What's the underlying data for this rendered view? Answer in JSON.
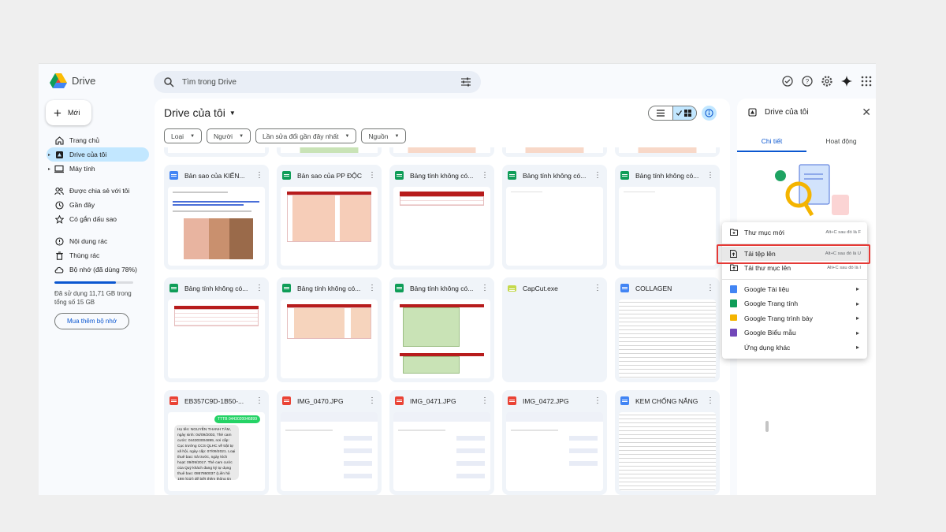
{
  "app": {
    "name": "Drive"
  },
  "search": {
    "placeholder": "Tìm trong Drive"
  },
  "sidebar": {
    "new_label": "Mới",
    "items": [
      {
        "label": "Trang chủ",
        "icon": "home-icon"
      },
      {
        "label": "Drive của tôi",
        "icon": "my-drive-icon",
        "active": true
      },
      {
        "label": "Máy tính",
        "icon": "computer-icon"
      },
      {
        "label": "Được chia sẻ với tôi",
        "icon": "shared-icon"
      },
      {
        "label": "Gần đây",
        "icon": "clock-icon"
      },
      {
        "label": "Có gắn dấu sao",
        "icon": "star-icon"
      },
      {
        "label": "Nội dung rác",
        "icon": "spam-icon"
      },
      {
        "label": "Thùng rác",
        "icon": "trash-icon"
      },
      {
        "label": "Bộ nhớ (đã dùng 78%)",
        "icon": "cloud-icon"
      }
    ],
    "storage_used_fraction": 0.78,
    "storage_text": "Đã sử dụng 11,71 GB trong tổng số 15 GB",
    "buy_label": "Mua thêm bộ nhớ"
  },
  "main": {
    "title": "Drive của tôi",
    "filters": [
      "Loại",
      "Người",
      "Lần sửa đổi gần đây nhất",
      "Nguồn"
    ],
    "files": [
      {
        "name": "Bản sao của KIẾN...",
        "type": "doc"
      },
      {
        "name": "Bản sao của PP ĐỘC...",
        "type": "sheet"
      },
      {
        "name": "Bảng tính không có...",
        "type": "sheet"
      },
      {
        "name": "Bảng tính không có...",
        "type": "sheet"
      },
      {
        "name": "Bảng tính không có...",
        "type": "sheet"
      },
      {
        "name": "Bảng tính không có...",
        "type": "sheet"
      },
      {
        "name": "Bảng tính không có...",
        "type": "sheet"
      },
      {
        "name": "Bảng tính không có...",
        "type": "sheet"
      },
      {
        "name": "CapCut.exe",
        "type": "exe"
      },
      {
        "name": "COLLAGEN",
        "type": "doc"
      },
      {
        "name": "EB357C9D-1B50-...",
        "type": "img"
      },
      {
        "name": "IMG_0470.JPG",
        "type": "img"
      },
      {
        "name": "IMG_0471.JPG",
        "type": "img"
      },
      {
        "name": "IMG_0472.JPG",
        "type": "img"
      },
      {
        "name": "KEM CHỐNG NẮNG",
        "type": "doc"
      }
    ],
    "chat_preview": {
      "badge": "TTTB 0443020046899",
      "text": "Họ tên: NGUYỄN THANH TÂM, ngày sinh: 04/09/2003, Thẻ cam cước: 044303004899, nơi cấp: Cục trưởng CCS QLHC về trật tự xã hội, ngày cấp: 07/09/2021. Loại thuê bao: trả trước, ngày kích hoạt: 09/09/2017. Thẻ cam cước của Quý khách đang ký tự dụng thuê bao: 0867860037 (Liên hệ 198 (Gửi) để biết thêm thông tin chi tiết. Trân trọng!"
    }
  },
  "details": {
    "title": "Drive của tôi",
    "tabs": [
      "Chi tiết",
      "Hoạt động"
    ]
  },
  "menu": {
    "items": [
      {
        "label": "Thư mục mới",
        "shortcut": "Alt+C sau đó là F",
        "icon": "new-folder-icon"
      },
      {
        "label": "Tải tệp lên",
        "shortcut": "Alt+C sau đó là U",
        "icon": "file-upload-icon",
        "highlighted": true
      },
      {
        "label": "Tải thư mục lên",
        "shortcut": "Alt+C sau đó là I",
        "icon": "folder-upload-icon"
      },
      {
        "label": "Google Tài liệu",
        "icon": "google-docs-icon",
        "color": "#4285f4"
      },
      {
        "label": "Google Trang tính",
        "icon": "google-sheets-icon",
        "color": "#0f9d58"
      },
      {
        "label": "Google Trang trình bày",
        "icon": "google-slides-icon",
        "color": "#f4b400"
      },
      {
        "label": "Google Biểu mẫu",
        "icon": "google-forms-icon",
        "color": "#7248b9"
      },
      {
        "label": "Ứng dụng khác",
        "icon": ""
      }
    ]
  },
  "colors": {
    "accent": "#0b57d0",
    "active_bg": "#c2e7ff",
    "highlight_box": "#e53935"
  }
}
